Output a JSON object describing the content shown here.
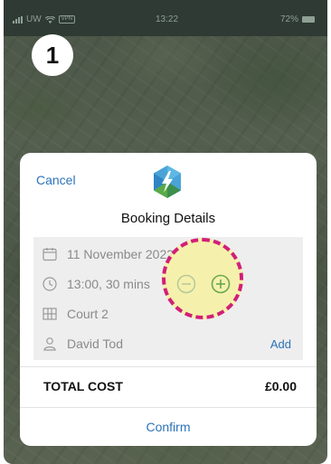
{
  "status_bar": {
    "carrier": "UW",
    "battery_pill": "VPN",
    "time": "13:22",
    "battery": "72%"
  },
  "step_badge": "1",
  "dialog": {
    "cancel_label": "Cancel",
    "title": "Booking Details",
    "date": "11 November 2022",
    "time_duration": "13:00, 30 mins",
    "court": "Court 2",
    "player": "David Tod",
    "add_label": "Add",
    "total_label": "TOTAL COST",
    "total_value": "£0.00",
    "confirm_label": "Confirm"
  },
  "colors": {
    "accent_blue": "#2d73b9",
    "highlight_fill": "#f6f1a0",
    "highlight_border": "#d21f76",
    "stepper_green": "#6aa84f"
  },
  "icons": [
    "app-logo-icon",
    "calendar-icon",
    "clock-icon",
    "court-grid-icon",
    "person-icon",
    "minus-circle-icon",
    "plus-circle-icon"
  ]
}
